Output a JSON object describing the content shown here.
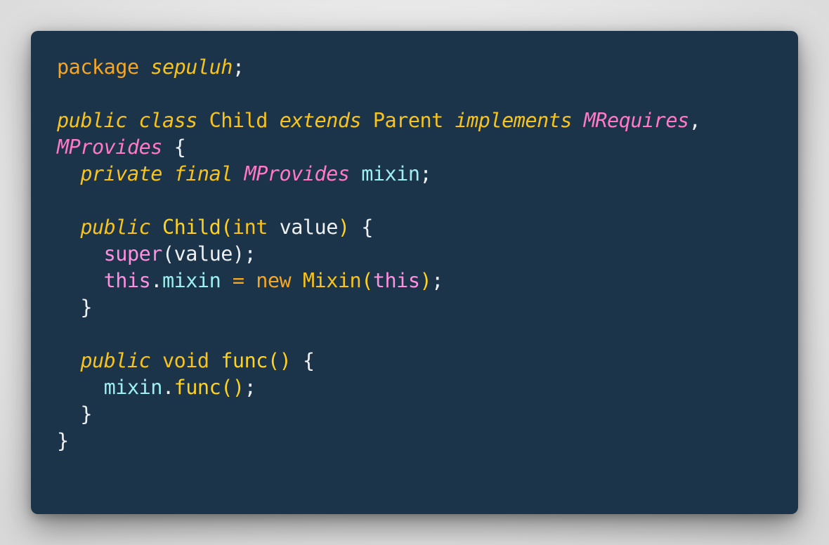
{
  "colors": {
    "background": "#1b344a",
    "keyword": "#f5a623",
    "italic_keyword": "#f7c31c",
    "interface": "#ff79c6",
    "identifier": "#9ef0f0",
    "plain": "#eef0f2"
  },
  "code": {
    "lines": [
      [
        {
          "t": "package",
          "c": "kw"
        },
        {
          "t": " ",
          "c": "pl"
        },
        {
          "t": "sepuluh",
          "c": "it"
        },
        {
          "t": ";",
          "c": "pl"
        }
      ],
      [],
      [
        {
          "t": "public",
          "c": "it"
        },
        {
          "t": " ",
          "c": "pl"
        },
        {
          "t": "class",
          "c": "it"
        },
        {
          "t": " ",
          "c": "pl"
        },
        {
          "t": "Child",
          "c": "ty"
        },
        {
          "t": " ",
          "c": "pl"
        },
        {
          "t": "extends",
          "c": "it"
        },
        {
          "t": " ",
          "c": "pl"
        },
        {
          "t": "Parent",
          "c": "ty"
        },
        {
          "t": " ",
          "c": "pl"
        },
        {
          "t": "implements",
          "c": "it"
        },
        {
          "t": " ",
          "c": "pl"
        },
        {
          "t": "MRequires",
          "c": "if"
        },
        {
          "t": ",",
          "c": "pl"
        }
      ],
      [
        {
          "t": "MProvides",
          "c": "if"
        },
        {
          "t": " {",
          "c": "pl"
        }
      ],
      [
        {
          "t": "  ",
          "c": "pl"
        },
        {
          "t": "private",
          "c": "it"
        },
        {
          "t": " ",
          "c": "pl"
        },
        {
          "t": "final",
          "c": "it"
        },
        {
          "t": " ",
          "c": "pl"
        },
        {
          "t": "MProvides",
          "c": "if"
        },
        {
          "t": " ",
          "c": "pl"
        },
        {
          "t": "mixin",
          "c": "var"
        },
        {
          "t": ";",
          "c": "pl"
        }
      ],
      [],
      [
        {
          "t": "  ",
          "c": "pl"
        },
        {
          "t": "public",
          "c": "it"
        },
        {
          "t": " ",
          "c": "pl"
        },
        {
          "t": "Child",
          "c": "fn"
        },
        {
          "t": "(",
          "c": "br"
        },
        {
          "t": "int",
          "c": "ty"
        },
        {
          "t": " value",
          "c": "pl"
        },
        {
          "t": ")",
          "c": "br"
        },
        {
          "t": " {",
          "c": "pl"
        }
      ],
      [
        {
          "t": "    ",
          "c": "pl"
        },
        {
          "t": "super",
          "c": "pk"
        },
        {
          "t": "(value);",
          "c": "pl"
        }
      ],
      [
        {
          "t": "    ",
          "c": "pl"
        },
        {
          "t": "this",
          "c": "pk"
        },
        {
          "t": ".",
          "c": "pl"
        },
        {
          "t": "mixin",
          "c": "var"
        },
        {
          "t": " = ",
          "c": "kw"
        },
        {
          "t": "new",
          "c": "kw"
        },
        {
          "t": " ",
          "c": "pl"
        },
        {
          "t": "Mixin",
          "c": "ty"
        },
        {
          "t": "(",
          "c": "br"
        },
        {
          "t": "this",
          "c": "pk"
        },
        {
          "t": ")",
          "c": "br"
        },
        {
          "t": ";",
          "c": "pl"
        }
      ],
      [
        {
          "t": "  }",
          "c": "pl"
        }
      ],
      [],
      [
        {
          "t": "  ",
          "c": "pl"
        },
        {
          "t": "public",
          "c": "it"
        },
        {
          "t": " ",
          "c": "pl"
        },
        {
          "t": "void",
          "c": "ty"
        },
        {
          "t": " ",
          "c": "pl"
        },
        {
          "t": "func",
          "c": "fn"
        },
        {
          "t": "()",
          "c": "br"
        },
        {
          "t": " {",
          "c": "pl"
        }
      ],
      [
        {
          "t": "    ",
          "c": "pl"
        },
        {
          "t": "mixin",
          "c": "var"
        },
        {
          "t": ".",
          "c": "pl"
        },
        {
          "t": "func",
          "c": "fn"
        },
        {
          "t": "()",
          "c": "br"
        },
        {
          "t": ";",
          "c": "pl"
        }
      ],
      [
        {
          "t": "  }",
          "c": "pl"
        }
      ],
      [
        {
          "t": "}",
          "c": "pl"
        }
      ]
    ]
  }
}
